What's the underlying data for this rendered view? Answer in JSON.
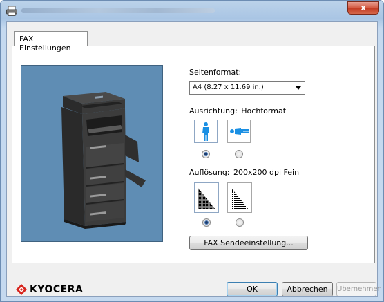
{
  "window": {
    "close_glyph": "x"
  },
  "tabs": [
    {
      "label": "FAX Einstellungen",
      "active": true
    }
  ],
  "page_format": {
    "label": "Seitenformat:",
    "selected": "A4 (8.27 x 11.69 in.)"
  },
  "orientation": {
    "label": "Ausrichtung:",
    "value": "Hochformat",
    "options": [
      {
        "icon": "portrait-person-icon",
        "selected": true
      },
      {
        "icon": "landscape-person-icon",
        "selected": false
      }
    ]
  },
  "resolution": {
    "label": "Auflösung:",
    "value": "200x200 dpi Fein",
    "options": [
      {
        "icon": "fine-resolution-icon",
        "selected": true
      },
      {
        "icon": "normal-resolution-icon",
        "selected": false
      }
    ]
  },
  "fax_send_button": "FAX Sendeeinstellung...",
  "footer": {
    "brand": "KYOCERA",
    "ok": "OK",
    "cancel": "Abbrechen",
    "apply": "Übernehmen"
  },
  "colors": {
    "preview_bg": "#5f8db4",
    "icon_blue": "#1a8fe3",
    "brand_red": "#d7261f"
  }
}
